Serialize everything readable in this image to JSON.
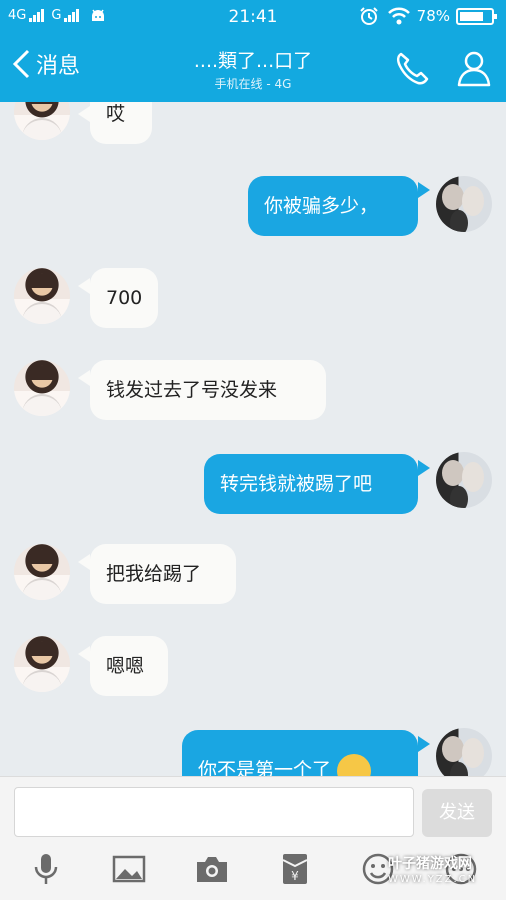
{
  "status_bar": {
    "network_1": "4G",
    "network_2": "G",
    "time": "21:41",
    "battery": "78%",
    "battery_level": 0.78
  },
  "header": {
    "back_label": "消息",
    "contact_name": "....類了...口了",
    "contact_status": "手机在线 - 4G"
  },
  "messages": [
    {
      "side": "in",
      "text": "哎"
    },
    {
      "side": "out",
      "text": "你被骗多少，"
    },
    {
      "side": "in",
      "text": "700"
    },
    {
      "side": "in",
      "text": "钱发过去了号没发来"
    },
    {
      "side": "out",
      "text": "转完钱就被踢了吧"
    },
    {
      "side": "in",
      "text": "把我给踢了"
    },
    {
      "side": "in",
      "text": "嗯嗯"
    },
    {
      "side": "out",
      "text": "你不是第一个了",
      "emoji": "flushed-face"
    }
  ],
  "composer": {
    "placeholder": "",
    "send_label": "发送"
  },
  "toolbar": {
    "icons": [
      "microphone-icon",
      "image-icon",
      "camera-icon",
      "red-packet-icon",
      "emoji-icon",
      "more-icon"
    ]
  },
  "watermark": {
    "text": "叶子猪游戏网",
    "url": "WWW.YZZ.CN"
  },
  "colors": {
    "header_bg": "#13a9e0",
    "outgoing_bubble": "#1aa6e2",
    "incoming_bubble": "#fafaf8",
    "chat_bg": "#e8ecef"
  }
}
